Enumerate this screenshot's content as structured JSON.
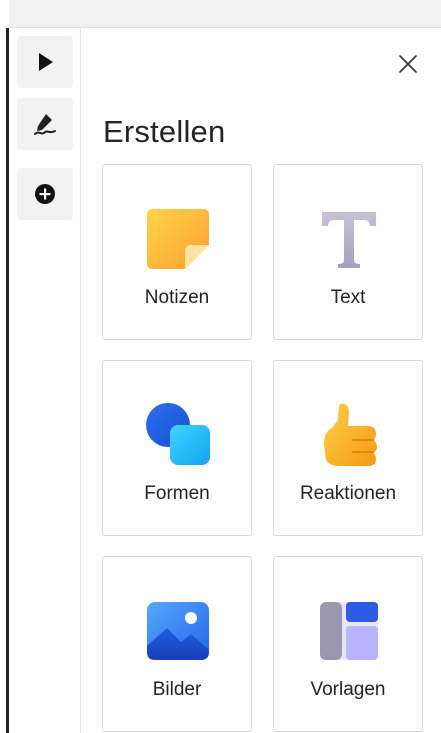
{
  "panel": {
    "title": "Erstellen",
    "items": [
      {
        "label": "Notizen",
        "icon": "sticky-note-icon"
      },
      {
        "label": "Text",
        "icon": "text-icon"
      },
      {
        "label": "Formen",
        "icon": "shapes-icon"
      },
      {
        "label": "Reaktionen",
        "icon": "thumbs-up-icon"
      },
      {
        "label": "Bilder",
        "icon": "image-icon"
      },
      {
        "label": "Vorlagen",
        "icon": "template-icon"
      }
    ]
  },
  "toolbar": {
    "tools": [
      {
        "icon": "pointer-icon"
      },
      {
        "icon": "pen-icon"
      },
      {
        "icon": "add-circle-icon"
      }
    ]
  },
  "colors": {
    "border": "#d8d8d8",
    "text": "#242424",
    "tool_bg": "#f2f2f2"
  }
}
